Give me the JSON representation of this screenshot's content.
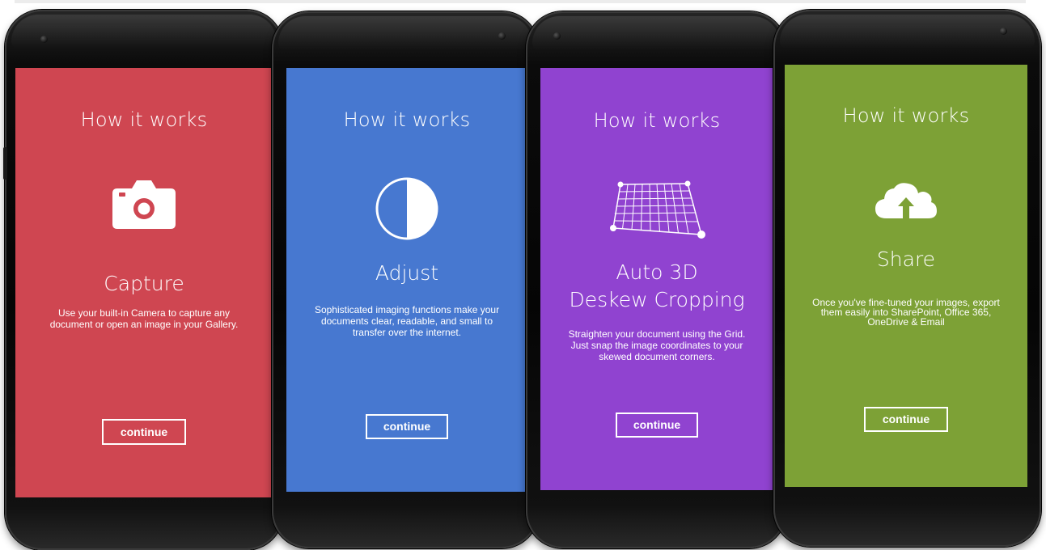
{
  "colors": {
    "red": "#cf4651",
    "blue": "#4778d0",
    "purple": "#9043d0",
    "green": "#7da136"
  },
  "screens": [
    {
      "title": "How it works",
      "icon": "camera-icon",
      "heading_line1": "Capture",
      "heading_line2": "",
      "desc_line1": "Use your built-in Camera to capture any",
      "desc_line2": "document or open an image in your Gallery.",
      "desc_line3": "",
      "button": "continue"
    },
    {
      "title": "How it works",
      "icon": "half-circle-contrast-icon",
      "heading_line1": "Adjust",
      "heading_line2": "",
      "desc_line1": "Sophisticated imaging functions make your",
      "desc_line2": "documents clear, readable, and small to",
      "desc_line3": "transfer over the internet.",
      "button": "continue"
    },
    {
      "title": "How it works",
      "icon": "perspective-grid-icon",
      "heading_line1": "Auto 3D",
      "heading_line2": "Deskew Cropping",
      "desc_line1": "Straighten your document using the Grid.",
      "desc_line2": "Just snap the image coordinates to your",
      "desc_line3": "skewed document corners.",
      "button": "continue"
    },
    {
      "title": "How it works",
      "icon": "cloud-upload-icon",
      "heading_line1": "Share",
      "heading_line2": "",
      "desc_line1": "Once you've fine-tuned your images, export",
      "desc_line2": "them easily into SharePoint, Office 365,",
      "desc_line3": "OneDrive & Email",
      "button": "continue"
    }
  ]
}
